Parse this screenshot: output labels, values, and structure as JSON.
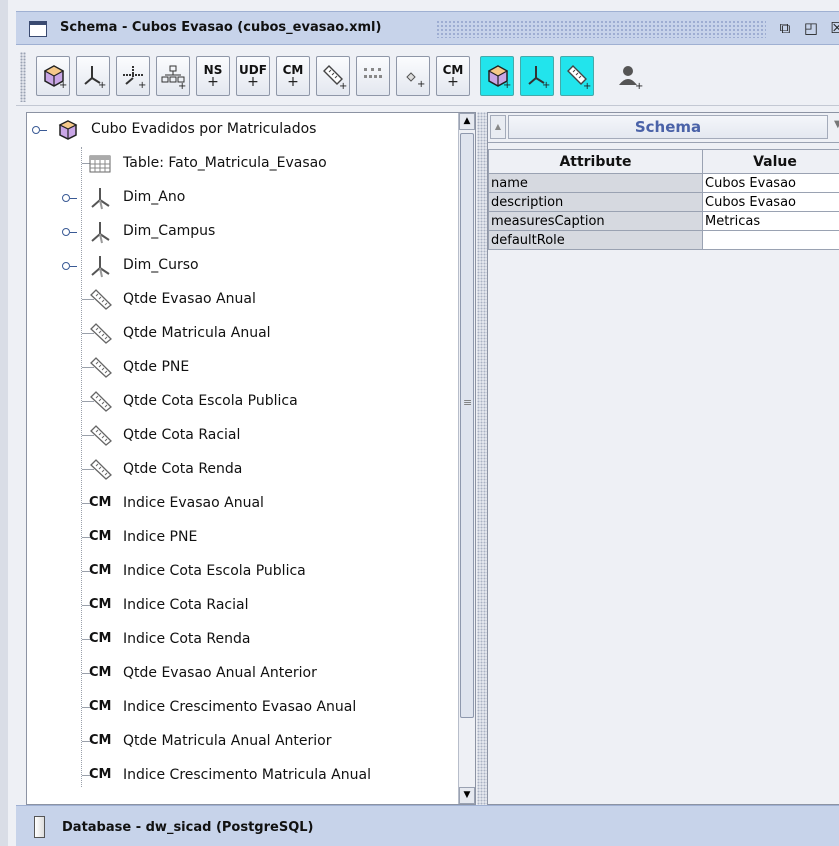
{
  "window": {
    "title": "Schema - Cubos Evasao (cubos_evasao.xml)",
    "restore_glyph": "⧉",
    "maximize_glyph": "◰",
    "close_glyph": "☒"
  },
  "toolbar": {
    "buttons": [
      {
        "id": "add-cube",
        "icon": "cube-add-icon"
      },
      {
        "id": "add-dimension",
        "icon": "dimension-add-icon"
      },
      {
        "id": "add-dimension-usage",
        "icon": "dimension-usage-add-icon"
      },
      {
        "id": "add-hierarchy",
        "icon": "hierarchy-add-icon"
      },
      {
        "id": "add-named-set",
        "text": "NS",
        "icon": "named-set-add-icon"
      },
      {
        "id": "add-udf",
        "text": "UDF",
        "icon": "udf-add-icon"
      },
      {
        "id": "add-calculated-member",
        "text": "CM",
        "icon": "calculated-member-add-icon"
      },
      {
        "id": "add-measure",
        "icon": "measure-add-icon"
      },
      {
        "id": "add-level",
        "icon": "level-add-icon"
      },
      {
        "id": "add-property",
        "icon": "property-add-icon"
      },
      {
        "id": "add-cm-property",
        "text": "CM",
        "icon": "cm-property-add-icon"
      },
      {
        "id": "add-virtual-cube",
        "icon": "virtual-cube-add-icon"
      },
      {
        "id": "add-virtual-dimension",
        "icon": "virtual-dimension-add-icon"
      },
      {
        "id": "add-virtual-measure",
        "icon": "virtual-measure-add-icon"
      },
      {
        "id": "add-role",
        "icon": "role-add-icon"
      }
    ],
    "plus": "+"
  },
  "tree": {
    "root": {
      "label": "Cubo Evadidos por Matriculados",
      "icon": "cube-icon"
    },
    "items": [
      {
        "type": "table",
        "label": "Table: Fato_Matricula_Evasao",
        "icon": "table-icon"
      },
      {
        "type": "dimension",
        "label": "Dim_Ano",
        "icon": "dimension-icon"
      },
      {
        "type": "dimension",
        "label": "Dim_Campus",
        "icon": "dimension-icon"
      },
      {
        "type": "dimension",
        "label": "Dim_Curso",
        "icon": "dimension-icon"
      },
      {
        "type": "measure",
        "label": "Qtde Evasao Anual",
        "icon": "measure-icon"
      },
      {
        "type": "measure",
        "label": "Qtde Matricula Anual",
        "icon": "measure-icon"
      },
      {
        "type": "measure",
        "label": "Qtde PNE",
        "icon": "measure-icon"
      },
      {
        "type": "measure",
        "label": "Qtde Cota Escola Publica",
        "icon": "measure-icon"
      },
      {
        "type": "measure",
        "label": "Qtde Cota Racial",
        "icon": "measure-icon"
      },
      {
        "type": "measure",
        "label": "Qtde Cota Renda",
        "icon": "measure-icon"
      },
      {
        "type": "calc",
        "label": "Indice Evasao Anual",
        "icon": "calculated-member-icon"
      },
      {
        "type": "calc",
        "label": "Indice PNE",
        "icon": "calculated-member-icon"
      },
      {
        "type": "calc",
        "label": "Indice Cota Escola Publica",
        "icon": "calculated-member-icon"
      },
      {
        "type": "calc",
        "label": "Indice Cota Racial",
        "icon": "calculated-member-icon"
      },
      {
        "type": "calc",
        "label": "Indice Cota Renda",
        "icon": "calculated-member-icon"
      },
      {
        "type": "calc",
        "label": "Qtde Evasao Anual Anterior",
        "icon": "calculated-member-icon"
      },
      {
        "type": "calc",
        "label": "Indice Crescimento Evasao Anual",
        "icon": "calculated-member-icon"
      },
      {
        "type": "calc",
        "label": "Qtde Matricula Anual Anterior",
        "icon": "calculated-member-icon"
      },
      {
        "type": "calc",
        "label": "Indice Crescimento Matricula Anual",
        "icon": "calculated-member-icon"
      }
    ],
    "cm_badge": "CM"
  },
  "properties": {
    "title": "Schema",
    "columns": {
      "attribute": "Attribute",
      "value": "Value"
    },
    "rows": [
      {
        "attribute": "name",
        "value": "Cubos Evasao"
      },
      {
        "attribute": "description",
        "value": "Cubos Evasao"
      },
      {
        "attribute": "measuresCaption",
        "value": "Metricas"
      },
      {
        "attribute": "defaultRole",
        "value": ""
      }
    ]
  },
  "status": {
    "database": "Database - dw_sicad (PostgreSQL)"
  },
  "colors": {
    "titlebar": "#c7d3ea",
    "highlight": "#22e4ec",
    "panel_title": "#4a62a8"
  }
}
